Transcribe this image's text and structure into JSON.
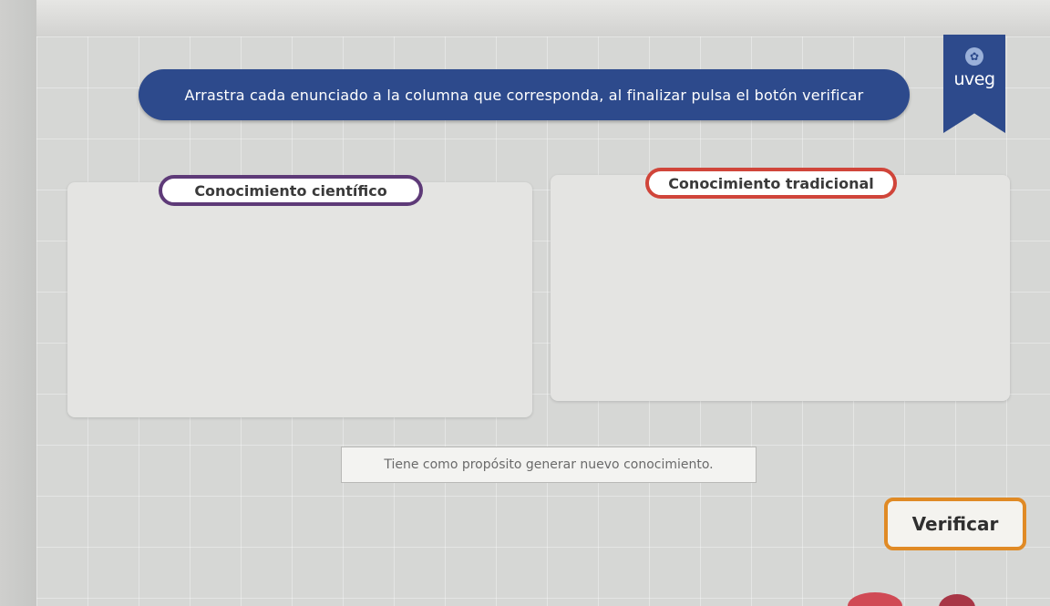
{
  "instruction": {
    "text": "Arrastra cada enunciado a la columna que corresponda, al finalizar pulsa el botón verificar"
  },
  "logo": {
    "text": "uveg",
    "brand_color": "#2d4a8c"
  },
  "columns": [
    {
      "label": "Conocimiento científico",
      "border_color": "#5e3a78"
    },
    {
      "label": "Conocimiento tradicional",
      "border_color": "#d0453a"
    }
  ],
  "statement": {
    "text": "Tiene como propósito generar nuevo conocimiento."
  },
  "verify_button": {
    "label": "Verificar",
    "border_color": "#e08a25"
  }
}
